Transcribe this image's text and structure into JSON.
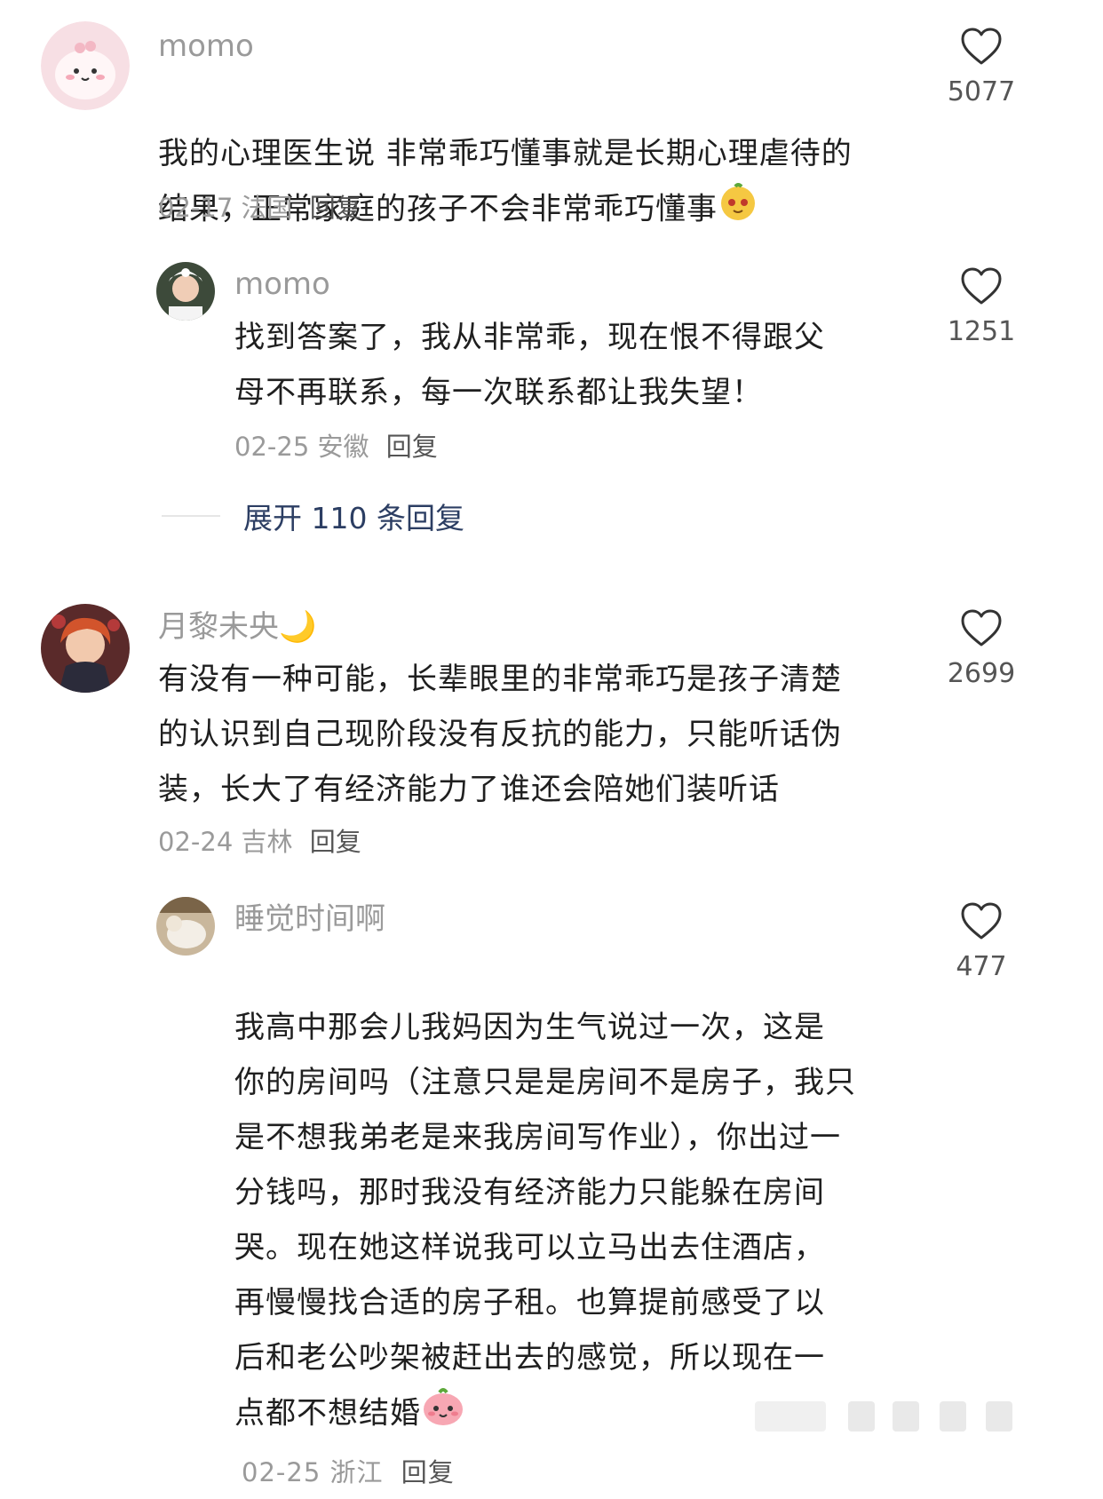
{
  "comments": [
    {
      "username": "momo",
      "text": "我的心理医生说 非常乖巧懂事就是长期心理虐待的\n结果，正常家庭的孩子不会非常乖巧懂事",
      "date": "02-17",
      "location": "法国",
      "reply_label": "回复",
      "likes": "5077",
      "reply": {
        "username": "momo",
        "text": "找到答案了，我从非常乖，现在恨不得跟父\n母不再联系，每一次联系都让我失望！",
        "date": "02-25",
        "location": "安徽",
        "reply_label": "回复",
        "likes": "1251"
      },
      "expand_label": "展开 110 条回复"
    },
    {
      "username": "月黎未央🌙",
      "text": "有没有一种可能，长辈眼里的非常乖巧是孩子清楚\n的认识到自己现阶段没有反抗的能力，只能听话伪\n装，长大了有经济能力了谁还会陪她们装听话",
      "date": "02-24",
      "location": "吉林",
      "reply_label": "回复",
      "likes": "2699",
      "reply": {
        "username": "睡觉时间啊",
        "text": "我高中那会儿我妈因为生气说过一次，这是\n你的房间吗（注意只是是房间不是房子，我只\n是不想我弟老是来我房间写作业），你出过一\n分钱吗，那时我没有经济能力只能躲在房间\n哭。现在她这样说我可以立马出去住酒店，\n再慢慢找合适的房子租。也算提前感受了以\n后和老公吵架被赶出去的感觉，所以现在一\n点都不想结婚",
        "date": "02-25",
        "location": "浙江",
        "reply_label": "回复",
        "likes": "477"
      }
    }
  ],
  "icons": {
    "like": "heart-outline-icon",
    "emoji_1": "orange-face-emoji",
    "emoji_2": "pink-face-emoji"
  },
  "colors": {
    "username": "#9a9a9a",
    "expand_link": "#2c3e63",
    "text": "#1f1f1f"
  }
}
